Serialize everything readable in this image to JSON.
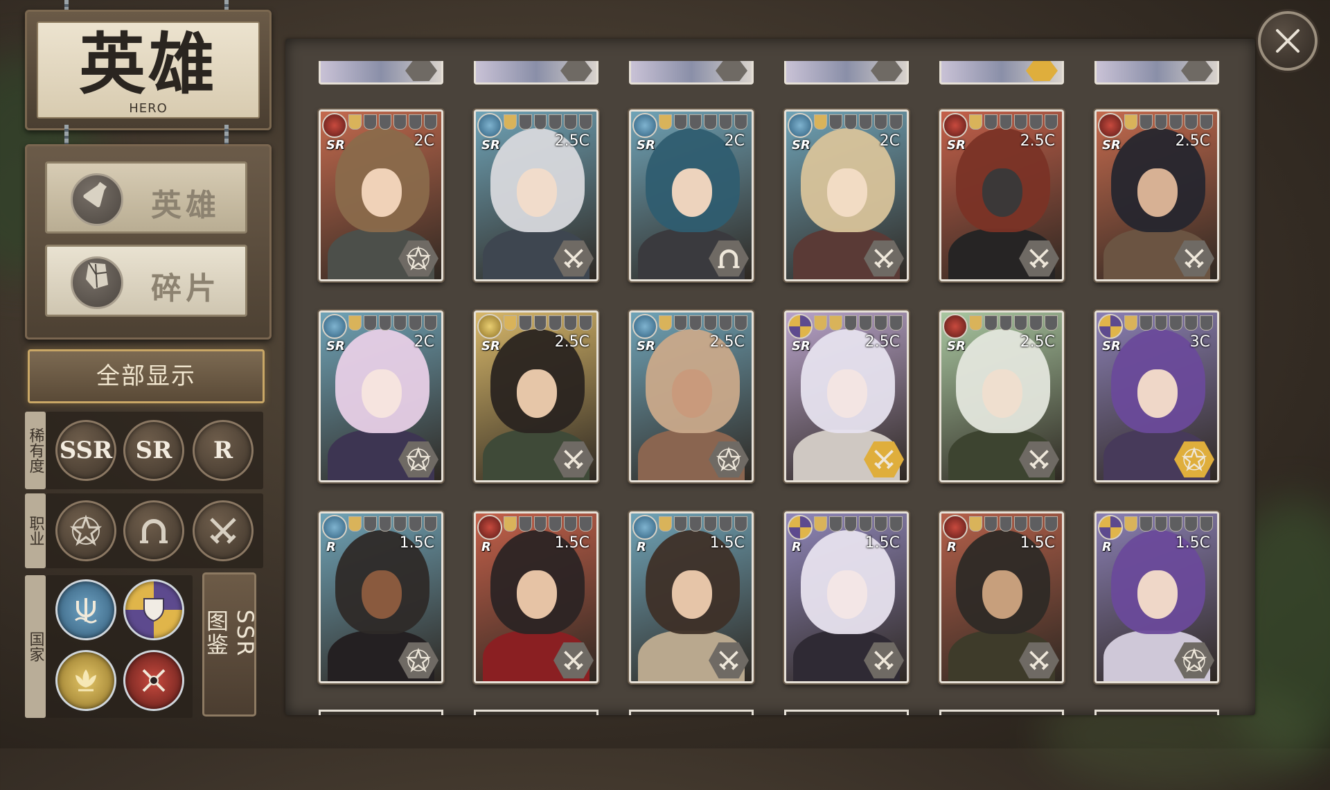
{
  "title": {
    "cn": "英雄",
    "en": "HERO"
  },
  "tabs": [
    {
      "label": "英雄",
      "icon": "potion-icon",
      "active": true
    },
    {
      "label": "碎片",
      "icon": "shard-icon",
      "active": false
    }
  ],
  "show_all_label": "全部显示",
  "filters": {
    "rarity": {
      "label": "稀有度",
      "options": [
        "SSR",
        "SR",
        "R"
      ]
    },
    "job": {
      "label": "职业",
      "options": [
        "mage-icon",
        "horseshoe-icon",
        "crossed-swords-icon"
      ]
    },
    "nation": {
      "label": "国家",
      "options": [
        "trident-icon",
        "shield-crest-icon",
        "lotus-icon",
        "crossed-blades-icon"
      ]
    }
  },
  "ssr_atlas_label": "SSR图鉴",
  "colors": {
    "gold": "#dfae3c",
    "panel": "#4a433b",
    "card_border": "#e6e0d6"
  },
  "cards": [
    {
      "rarity": "SR",
      "cost": "2C",
      "nation": "crossed-blades",
      "job": "mage",
      "stars": 1,
      "bg": "#c46a4e",
      "hair": "#8a6a4b",
      "skin": "#f0d2b8",
      "outfit": "#4c4f4a",
      "job_gold": false
    },
    {
      "rarity": "SR",
      "cost": "2.5C",
      "nation": "trident",
      "job": "swords",
      "stars": 1,
      "bg": "#6fa3b7",
      "hair": "#d7d8dc",
      "skin": "#f1dccb",
      "outfit": "#3e4650",
      "job_gold": false
    },
    {
      "rarity": "SR",
      "cost": "2C",
      "nation": "trident",
      "job": "horseshoe",
      "stars": 1,
      "bg": "#6fa3b7",
      "hair": "#2f5d70",
      "skin": "#edd3bd",
      "outfit": "#3a3a3e",
      "job_gold": false
    },
    {
      "rarity": "SR",
      "cost": "2C",
      "nation": "trident",
      "job": "swords",
      "stars": 1,
      "bg": "#6fa3b7",
      "hair": "#d8c39a",
      "skin": "#f2dcc4",
      "outfit": "#5a3a36",
      "job_gold": false
    },
    {
      "rarity": "SR",
      "cost": "2.5C",
      "nation": "crossed-blades",
      "job": "swords",
      "stars": 1,
      "bg": "#c4604a",
      "hair": "#7a3326",
      "skin": "#3b3838",
      "outfit": "#262424",
      "job_gold": false
    },
    {
      "rarity": "SR",
      "cost": "2.5C",
      "nation": "crossed-blades",
      "job": "swords",
      "stars": 1,
      "bg": "#c46a4e",
      "hair": "#26262e",
      "skin": "#d7b194",
      "outfit": "#6b5442",
      "job_gold": false
    },
    {
      "rarity": "SR",
      "cost": "2C",
      "nation": "trident",
      "job": "mage",
      "stars": 1,
      "bg": "#6fa3b7",
      "hair": "#e7cfe6",
      "skin": "#f6e4df",
      "outfit": "#3d3552",
      "job_gold": false
    },
    {
      "rarity": "SR",
      "cost": "2.5C",
      "nation": "lotus",
      "job": "swords",
      "stars": 1,
      "bg": "#d7b76a",
      "hair": "#2a2420",
      "skin": "#e6c6a8",
      "outfit": "#3f4a38",
      "job_gold": false
    },
    {
      "rarity": "SR",
      "cost": "2.5C",
      "nation": "trident",
      "job": "mage",
      "stars": 1,
      "bg": "#6fa3b7",
      "hair": "#c9a98a",
      "skin": "#c99a7c",
      "outfit": "#8a6550",
      "job_gold": false
    },
    {
      "rarity": "SR",
      "cost": "2.5C",
      "nation": "shield-crest",
      "job": "swords",
      "stars": 2,
      "bg": "#b7a2c9",
      "hair": "#e6e2ee",
      "skin": "#f3e5e3",
      "outfit": "#cfc8c2",
      "job_gold": true
    },
    {
      "rarity": "SR",
      "cost": "2.5C",
      "nation": "crossed-blades",
      "job": "swords",
      "stars": 1,
      "bg": "#a9c7a1",
      "hair": "#e3e6dc",
      "skin": "#efdfcf",
      "outfit": "#3d4430",
      "job_gold": false
    },
    {
      "rarity": "SR",
      "cost": "3C",
      "nation": "shield-crest",
      "job": "mage",
      "stars": 1,
      "bg": "#8a7fb4",
      "hair": "#6a4a9a",
      "skin": "#efd7c8",
      "outfit": "#473a5a",
      "job_gold": true
    },
    {
      "rarity": "R",
      "cost": "1.5C",
      "nation": "trident",
      "job": "mage",
      "stars": 1,
      "bg": "#6fa3b7",
      "hair": "#2e2a28",
      "skin": "#8a5a3e",
      "outfit": "#242022",
      "job_gold": false
    },
    {
      "rarity": "R",
      "cost": "1.5C",
      "nation": "crossed-blades",
      "job": "swords",
      "stars": 1,
      "bg": "#c4604a",
      "hair": "#2c2424",
      "skin": "#e6c3a5",
      "outfit": "#8a1f22",
      "job_gold": false
    },
    {
      "rarity": "R",
      "cost": "1.5C",
      "nation": "trident",
      "job": "swords",
      "stars": 1,
      "bg": "#6fa3b7",
      "hair": "#3e3028",
      "skin": "#e6c5a8",
      "outfit": "#b9a88e",
      "job_gold": false
    },
    {
      "rarity": "R",
      "cost": "1.5C",
      "nation": "shield-crest",
      "job": "swords",
      "stars": 1,
      "bg": "#8f86b9",
      "hair": "#e7e2ee",
      "skin": "#f3e6e6",
      "outfit": "#2f2a34",
      "job_gold": false
    },
    {
      "rarity": "R",
      "cost": "1.5C",
      "nation": "crossed-blades",
      "job": "swords",
      "stars": 1,
      "bg": "#b5604a",
      "hair": "#2e2a26",
      "skin": "#c79f7c",
      "outfit": "#3e3b2a",
      "job_gold": false
    },
    {
      "rarity": "R",
      "cost": "1.5C",
      "nation": "shield-crest",
      "job": "mage",
      "stars": 1,
      "bg": "#8a7fb4",
      "hair": "#6a4a9a",
      "skin": "#efd7c8",
      "outfit": "#cfc8d8",
      "job_gold": false
    }
  ],
  "top_partial_cards": [
    {
      "job": "swords",
      "job_gold": false
    },
    {
      "job": "swords",
      "job_gold": false
    },
    {
      "job": "horseshoe",
      "job_gold": false
    },
    {
      "job": "horseshoe",
      "job_gold": false
    },
    {
      "job": "swords",
      "job_gold": true
    },
    {
      "job": "mage",
      "job_gold": false
    }
  ]
}
